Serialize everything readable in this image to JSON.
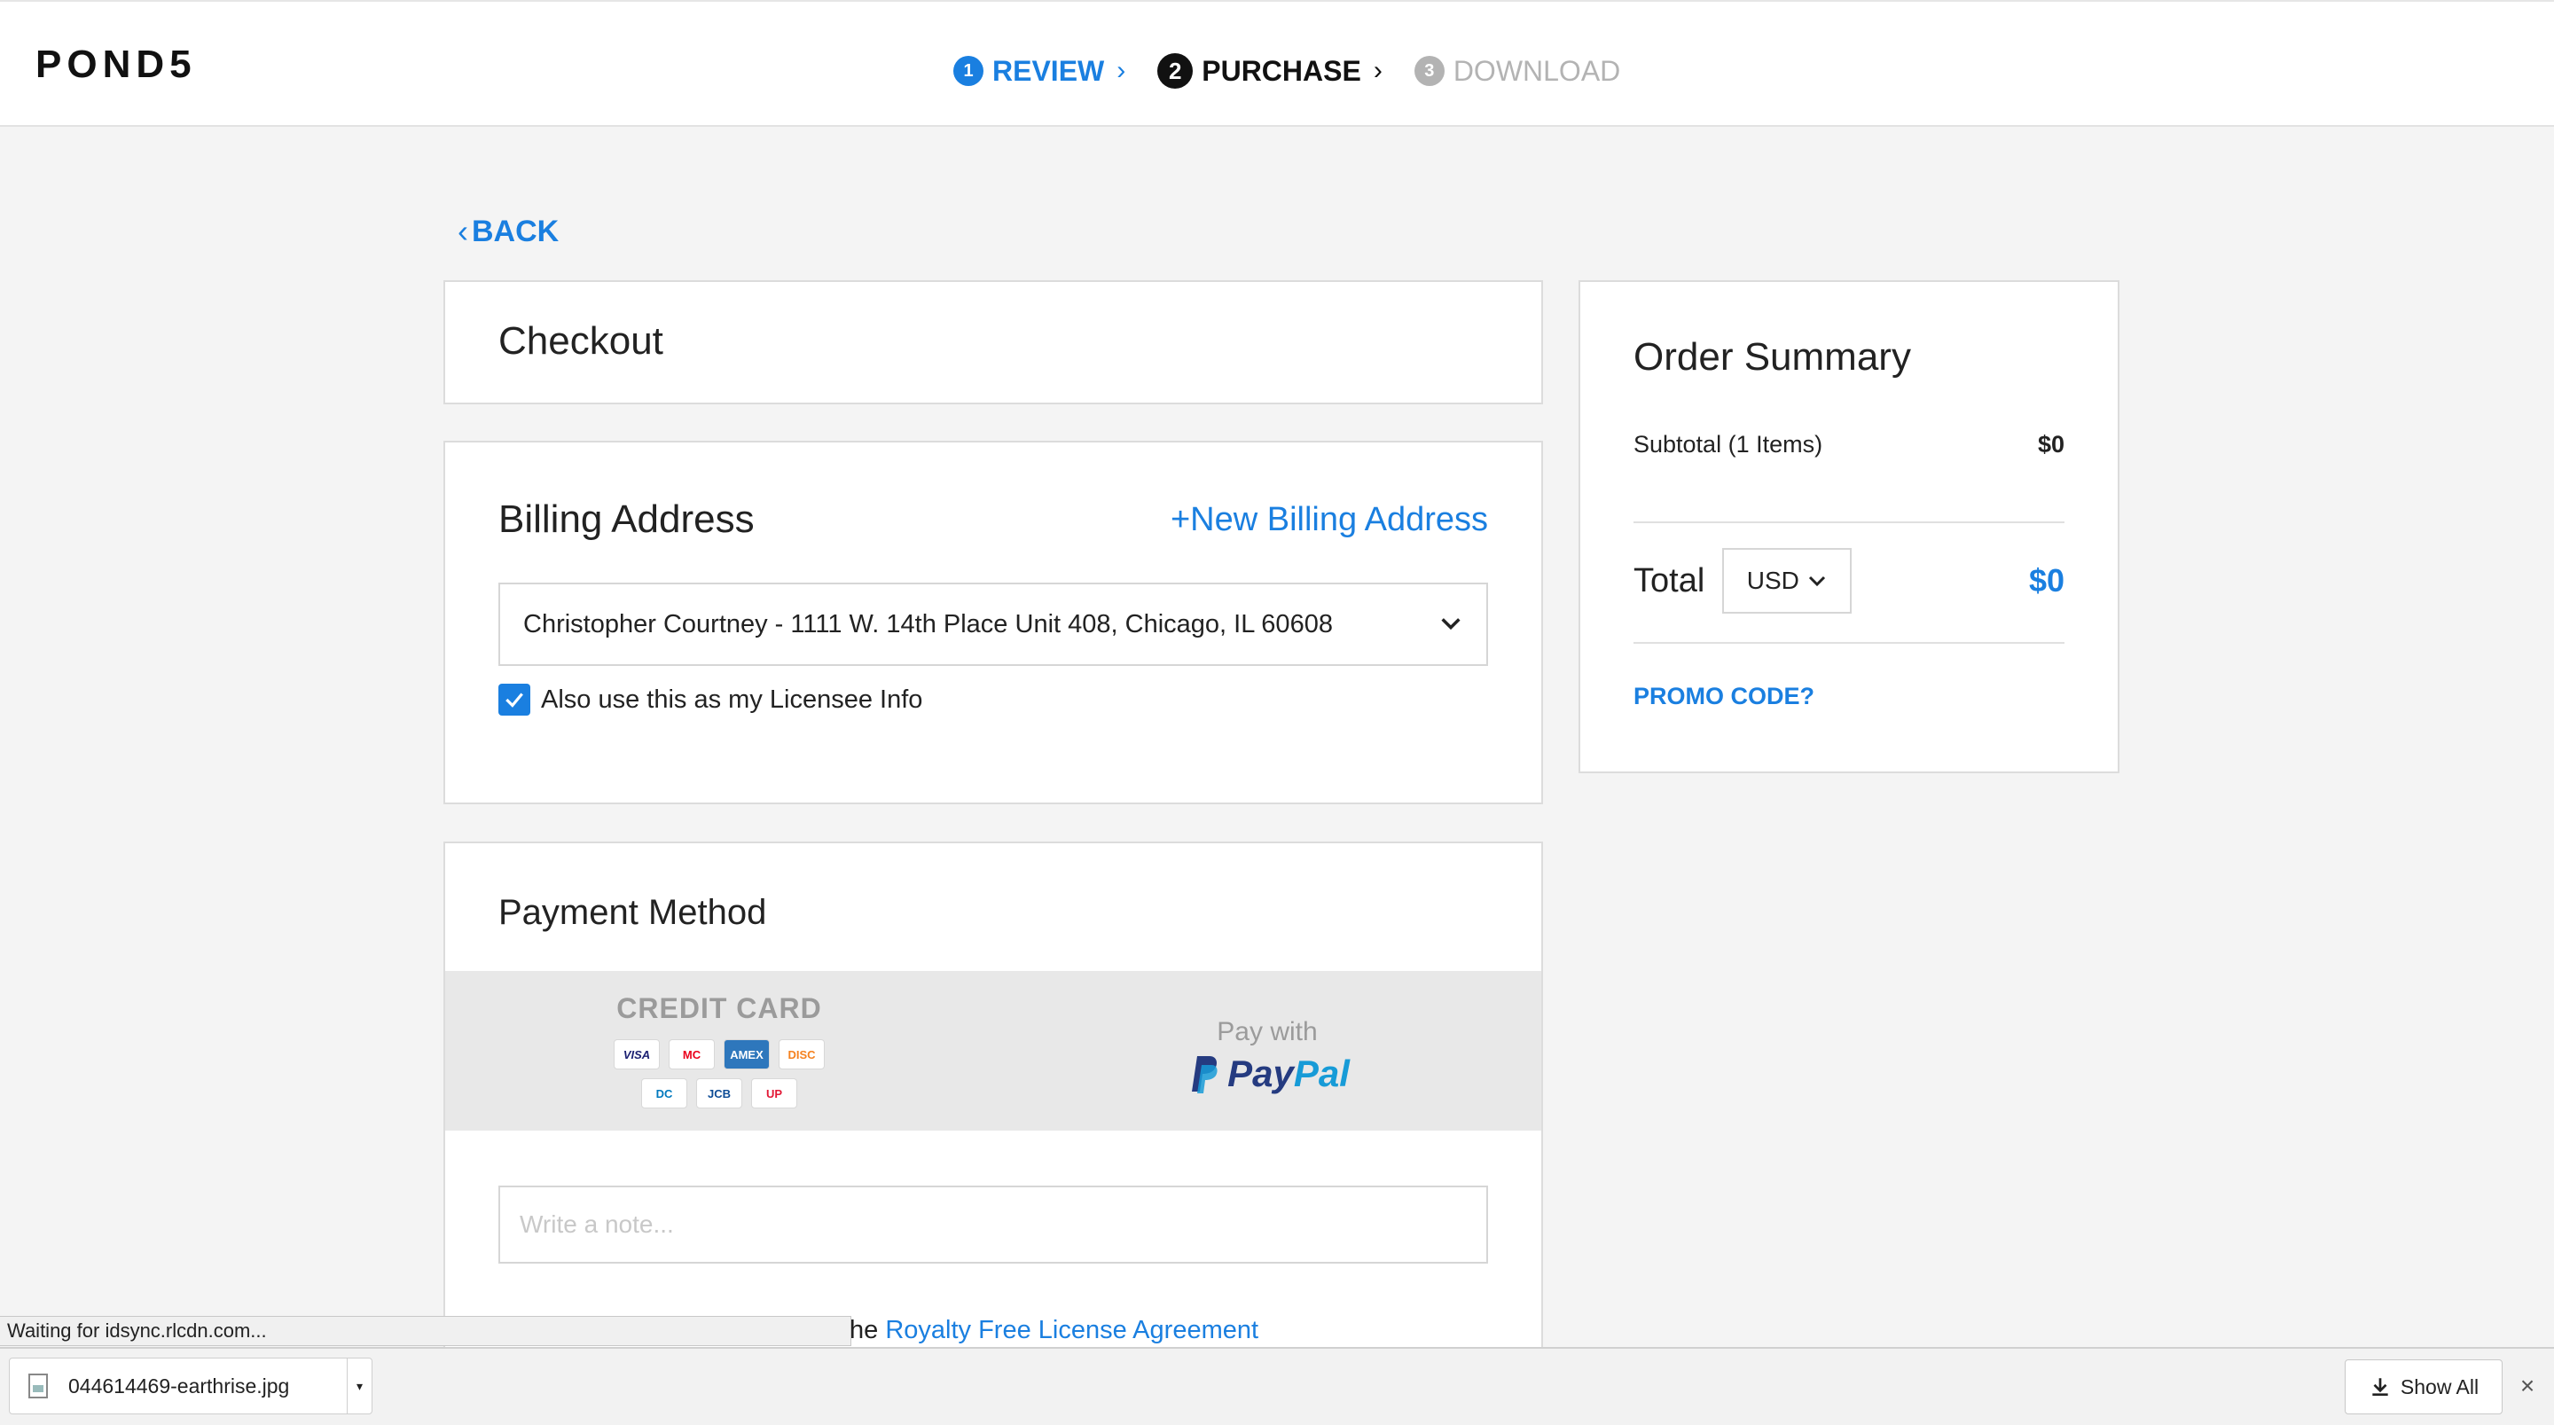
{
  "header": {
    "logo": "POND5",
    "steps": [
      {
        "num": "1",
        "label": "REVIEW",
        "state": "done"
      },
      {
        "num": "2",
        "label": "PURCHASE",
        "state": "active"
      },
      {
        "num": "3",
        "label": "DOWNLOAD",
        "state": "pending"
      }
    ]
  },
  "back": {
    "label": "BACK"
  },
  "checkout": {
    "title": "Checkout"
  },
  "billing": {
    "title": "Billing Address",
    "new_link": "+New Billing Address",
    "selected_address": "Christopher Courtney - 1111 W. 14th Place Unit 408, Chicago, IL 60608",
    "licensee_checkbox_label": "Also use this as my Licensee Info",
    "licensee_checked": true
  },
  "payment": {
    "title": "Payment Method",
    "credit_card_label": "CREDIT CARD",
    "card_brands_row1": [
      "VISA",
      "MC",
      "AMEX",
      "DISC"
    ],
    "card_brands_row2": [
      "DC",
      "JCB",
      "UP"
    ],
    "paypal_prefix": "Pay with",
    "paypal_word_1": "Pay",
    "paypal_word_2": "Pal",
    "note_placeholder": "Write a note...",
    "license_prefix": "he ",
    "license_link": "Royalty Free License Agreement"
  },
  "summary": {
    "title": "Order Summary",
    "subtotal_label": "Subtotal (1 Items)",
    "subtotal_value": "$0",
    "total_label": "Total",
    "currency": "USD",
    "total_value": "$0",
    "promo_label": "PROMO CODE?"
  },
  "browser": {
    "status_text": "Waiting for idsync.rlcdn.com...",
    "download_file": "044614469-earthrise.jpg",
    "show_all_label": "Show All",
    "close_glyph": "×"
  },
  "colors": {
    "accent": "#1a7fe0",
    "step_done": "#1a7fe0",
    "step_active": "#111111",
    "step_pending": "#b3b3b3",
    "paypal_dark": "#253b80",
    "paypal_light": "#179bd7",
    "disabled_text": "#b3b3b3"
  }
}
